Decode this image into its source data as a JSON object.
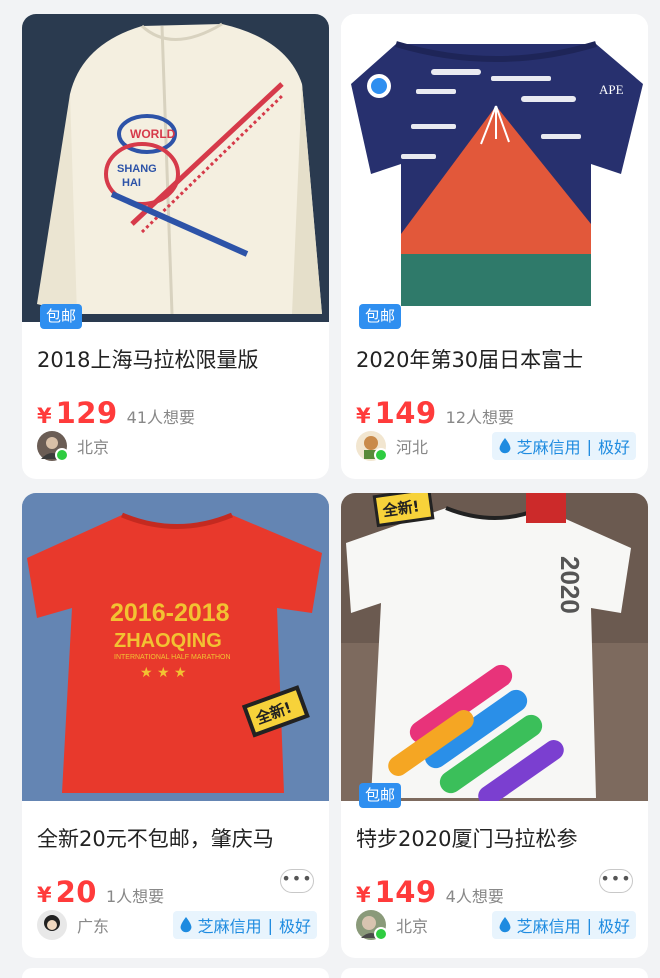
{
  "cards": [
    {
      "badge": "包邮",
      "title": "2018上海马拉松限量版",
      "currency": "¥",
      "price": "129",
      "wants": "41人想要",
      "location": "北京",
      "shirt_text": [
        "WORLD",
        "SHANG",
        "HAI"
      ]
    },
    {
      "badge": "包邮",
      "title": "2020年第30届日本富士",
      "currency": "¥",
      "price": "149",
      "wants": "12人想要",
      "location": "河北",
      "credit": {
        "label": "芝麻信用",
        "level": "极好"
      },
      "shirt_text": [
        "APE"
      ]
    },
    {
      "title": "全新20元不包邮，肇庆马",
      "currency": "¥",
      "price": "20",
      "wants": "1人想要",
      "more": "•••",
      "location": "广东",
      "credit": {
        "label": "芝麻信用",
        "level": "极好"
      },
      "shirt_text": [
        "2016-2018",
        "ZHAOQING",
        "INTERNATIONAL HALF MARATHON",
        "★ ★ ★"
      ],
      "sticker": "全新!"
    },
    {
      "badge": "包邮",
      "title": "特步2020厦门马拉松参",
      "currency": "¥",
      "price": "149",
      "wants": "4人想要",
      "more": "•••",
      "location": "北京",
      "credit": {
        "label": "芝麻信用",
        "level": "极好"
      },
      "shirt_text": [
        "2020"
      ],
      "sticker": "全新!"
    }
  ],
  "colors": {
    "price": "#ff3b3b",
    "badge": "#2f8ff0",
    "credit_text": "#1e8be0",
    "credit_bg": "#e8f4fd",
    "page_bg": "#f2f3f5"
  }
}
